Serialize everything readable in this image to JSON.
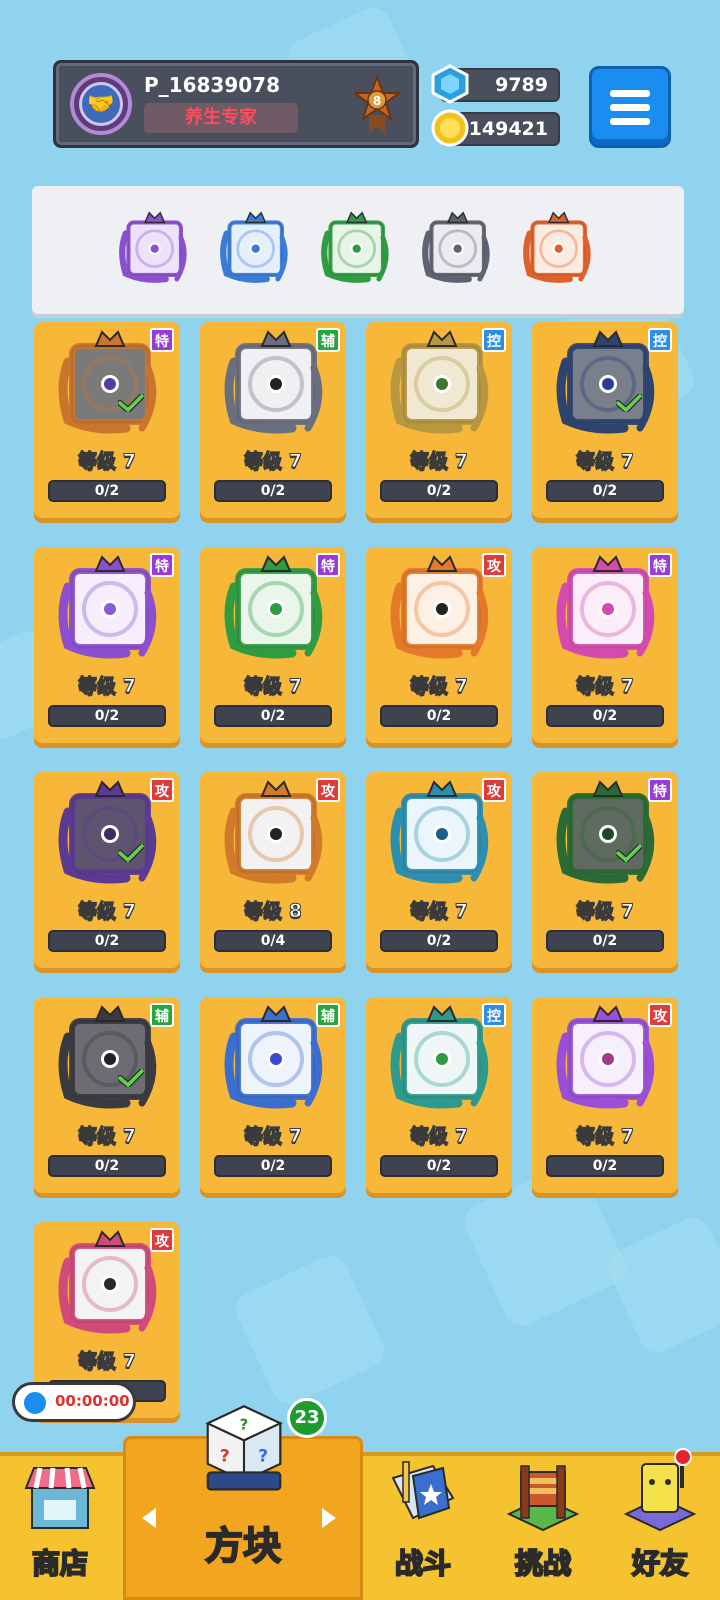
{
  "player": {
    "name": "P_16839078",
    "title": "养生专家",
    "rank": "8"
  },
  "currency": {
    "gems": "9789",
    "gold": "149421"
  },
  "colors": {
    "attack": "#e03b3b",
    "support": "#27a641",
    "control": "#2c8ee6",
    "special": "#9a3bd8"
  },
  "deck": [
    {
      "name": "purple-rune-dice",
      "frame": "#8c4fd0",
      "bg": "#ece3fa",
      "icon": "rune-icon"
    },
    {
      "name": "snowflake-dice",
      "frame": "#3a7bd6",
      "bg": "#e5f0fc",
      "icon": "snowflake-icon"
    },
    {
      "name": "green-vine-dice",
      "frame": "#2f9c42",
      "bg": "#e6f5e7",
      "icon": "vine-icon"
    },
    {
      "name": "grey-gear-dice",
      "frame": "#5f6270",
      "bg": "#ececee",
      "icon": "gear-icon"
    },
    {
      "name": "infinity-dice",
      "frame": "#e0602c",
      "bg": "#fbece2",
      "icon": "infinity-icon"
    }
  ],
  "cards": [
    {
      "tag": "特",
      "tag_type": "special",
      "level": "等级 7",
      "progress": "0/2",
      "fill": 0,
      "frame": "#c9752d",
      "bg": "#7a7a7a",
      "dot": "#5a3aa0",
      "checked": true,
      "icon": "infinity-icon"
    },
    {
      "tag": "辅",
      "tag_type": "support",
      "level": "等级 7",
      "progress": "0/2",
      "fill": 0,
      "frame": "#6a6f80",
      "bg": "#f0f0f2",
      "dot": "#222",
      "checked": false,
      "icon": "fangs-icon"
    },
    {
      "tag": "控",
      "tag_type": "control",
      "level": "等级 7",
      "progress": "0/2",
      "fill": 0,
      "frame": "#b79740",
      "bg": "#efe9d3",
      "dot": "#3c7a2a",
      "checked": false,
      "icon": "shield-icon"
    },
    {
      "tag": "控",
      "tag_type": "control",
      "level": "等级 7",
      "progress": "0/2",
      "fill": 0,
      "frame": "#2d4470",
      "bg": "#7a7f8c",
      "dot": "#2a3e90",
      "checked": true,
      "icon": "snowflake-icon"
    },
    {
      "tag": "特",
      "tag_type": "special",
      "level": "等级 7",
      "progress": "0/2",
      "fill": 0,
      "frame": "#8c4fd0",
      "bg": "#f4eefd",
      "dot": "#8a5ad8",
      "checked": false,
      "icon": "arrows-up-icon"
    },
    {
      "tag": "特",
      "tag_type": "special",
      "level": "等级 7",
      "progress": "0/2",
      "fill": 0,
      "frame": "#2f9c42",
      "bg": "#eaf6ec",
      "dot": "#2f9c42",
      "checked": false,
      "icon": "pentagram-icon"
    },
    {
      "tag": "攻",
      "tag_type": "attack",
      "level": "等级 7",
      "progress": "0/2",
      "fill": 0,
      "frame": "#e6782a",
      "bg": "#fdf1e6",
      "dot": "#222",
      "checked": false,
      "icon": "flame-icon"
    },
    {
      "tag": "特",
      "tag_type": "special",
      "level": "等级 7",
      "progress": "0/2",
      "fill": 0,
      "frame": "#d44ab0",
      "bg": "#fbeef8",
      "dot": "#d44ab0",
      "checked": false,
      "icon": "syringe-icon"
    },
    {
      "tag": "攻",
      "tag_type": "attack",
      "level": "等级 7",
      "progress": "0/2",
      "fill": 0,
      "frame": "#5a3a92",
      "bg": "#5e546f",
      "dot": "#3a2a6a",
      "checked": true,
      "icon": "rune-icon"
    },
    {
      "tag": "攻",
      "tag_type": "attack",
      "level": "等级 8",
      "progress": "0/4",
      "fill": 0,
      "frame": "#d17a2a",
      "bg": "#f2f2f2",
      "dot": "#222",
      "checked": false,
      "icon": "pistol-icon"
    },
    {
      "tag": "攻",
      "tag_type": "attack",
      "level": "等级 7",
      "progress": "0/2",
      "fill": 0,
      "frame": "#2c8eb0",
      "bg": "#eaf6fb",
      "dot": "#1a5e8a",
      "checked": false,
      "icon": "vortex-icon"
    },
    {
      "tag": "特",
      "tag_type": "special",
      "level": "等级 7",
      "progress": "0/2",
      "fill": 0,
      "frame": "#2a6a34",
      "bg": "#5f6b60",
      "dot": "#1f4a26",
      "checked": true,
      "icon": "vine-icon"
    },
    {
      "tag": "辅",
      "tag_type": "support",
      "level": "等级 7",
      "progress": "0/2",
      "fill": 0,
      "frame": "#3a3a42",
      "bg": "#6c6c72",
      "dot": "#222",
      "checked": true,
      "icon": "gear-icon"
    },
    {
      "tag": "辅",
      "tag_type": "support",
      "level": "等级 7",
      "progress": "0/2",
      "fill": 0,
      "frame": "#3a6fd0",
      "bg": "#eef3fc",
      "dot": "#3a4ad0",
      "checked": false,
      "icon": "moon-icon"
    },
    {
      "tag": "控",
      "tag_type": "control",
      "level": "等级 7",
      "progress": "0/2",
      "fill": 0,
      "frame": "#2c9a8c",
      "bg": "#eef7f6",
      "dot": "#2f9c42",
      "checked": false,
      "icon": "wind-icon"
    },
    {
      "tag": "攻",
      "tag_type": "attack",
      "level": "等级 7",
      "progress": "0/2",
      "fill": 0,
      "frame": "#9a4fd8",
      "bg": "#f6f0fd",
      "dot": "#a23a8a",
      "checked": false,
      "icon": "star-icon"
    },
    {
      "tag": "攻",
      "tag_type": "attack",
      "level": "等级 7",
      "progress": "1/2",
      "fill": 0.5,
      "frame": "#d24a7a",
      "bg": "#f3f3f3",
      "dot": "#2a2a2a",
      "checked": false,
      "icon": "saw-blade-icon"
    }
  ],
  "timer": "00:00:00",
  "nav": {
    "shop": "商店",
    "dice": "方块",
    "battle": "战斗",
    "challenge": "挑战",
    "friends": "好友",
    "dice_badge": "23"
  }
}
